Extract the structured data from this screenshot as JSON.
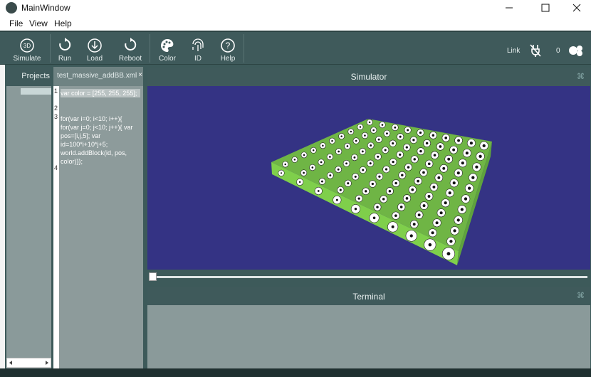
{
  "window": {
    "title": "MainWindow",
    "minimize": "—",
    "maximize": "☐",
    "close": "✕"
  },
  "menu": [
    "File",
    "View",
    "Help"
  ],
  "toolbar": {
    "simulate": "Simulate",
    "run": "Run",
    "load": "Load",
    "reboot": "Reboot",
    "color": "Color",
    "id": "ID",
    "help": "Help",
    "link": "Link",
    "count": "0",
    "badge": "3D"
  },
  "projects": {
    "tab": "Projects"
  },
  "editor": {
    "tab": "test_massive_addBB.xml",
    "tab_close": "×",
    "line_numbers": [
      "1",
      "2",
      "3",
      "4"
    ],
    "lines": [
      "var color = [255, 255, 255];",
      "",
      "for(var i=0; i<10; i++){ for(var j=0; j<10; j++){ var pos=[i,j,5]; var id=100*i+10*j+5; world.addBlock(id, pos, color)}};",
      ""
    ]
  },
  "simulator": {
    "title": "Simulator",
    "close": "⌘",
    "slider_value": 0
  },
  "terminal": {
    "title": "Terminal",
    "close": "⌘"
  },
  "colors": {
    "viewport": "#343384",
    "block": "#8fd85a",
    "panel": "#3f5a5b"
  },
  "icons": [
    "3d-simulate-icon",
    "run-icon",
    "load-icon",
    "reboot-icon",
    "palette-icon",
    "fingerprint-icon",
    "help-icon",
    "link-off-icon",
    "blinky-logo-icon"
  ]
}
